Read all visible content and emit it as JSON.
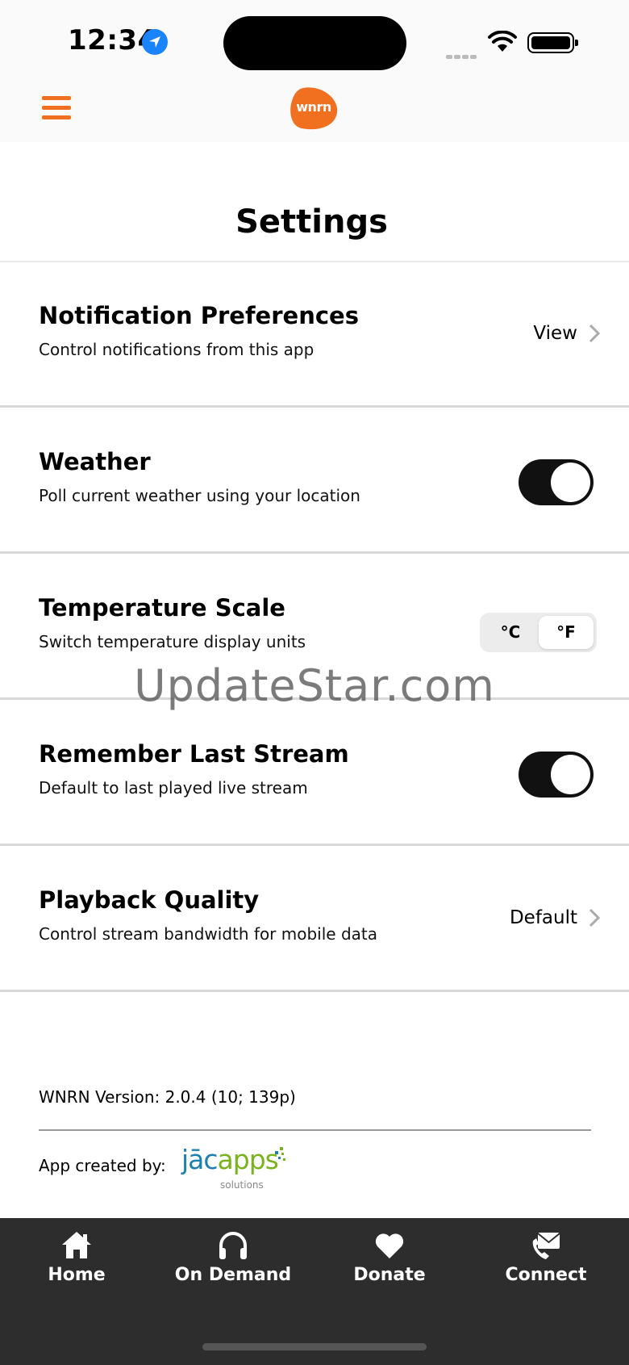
{
  "status_bar": {
    "time": "12:34"
  },
  "header": {
    "logo_text": "wnrn",
    "brand_color": "#f07020"
  },
  "page": {
    "title": "Settings"
  },
  "settings": {
    "notification": {
      "title": "Notification Preferences",
      "description": "Control notifications from this app",
      "action": "View"
    },
    "weather": {
      "title": "Weather",
      "description": "Poll current weather using your location",
      "enabled": true
    },
    "temperature": {
      "title": "Temperature Scale",
      "description": "Switch temperature display units",
      "option_c": "°C",
      "option_f": "°F",
      "selected": "°F"
    },
    "remember_stream": {
      "title": "Remember Last Stream",
      "description": "Default to last played live stream",
      "enabled": true
    },
    "playback": {
      "title": "Playback Quality",
      "description": "Control stream bandwidth for mobile data",
      "action": "Default"
    }
  },
  "watermark": "UpdateStar.com",
  "footer": {
    "version": "WNRN Version: 2.0.4 (10; 139p)",
    "credit_label": "App created by:",
    "credit_logo_main": "jāc",
    "credit_logo_accent": "apps",
    "credit_logo_sub": "solutions"
  },
  "tabs": [
    {
      "label": "Home",
      "icon": "home-icon"
    },
    {
      "label": "On Demand",
      "icon": "headphones-icon"
    },
    {
      "label": "Donate",
      "icon": "heart-icon"
    },
    {
      "label": "Connect",
      "icon": "mail-phone-icon"
    }
  ]
}
